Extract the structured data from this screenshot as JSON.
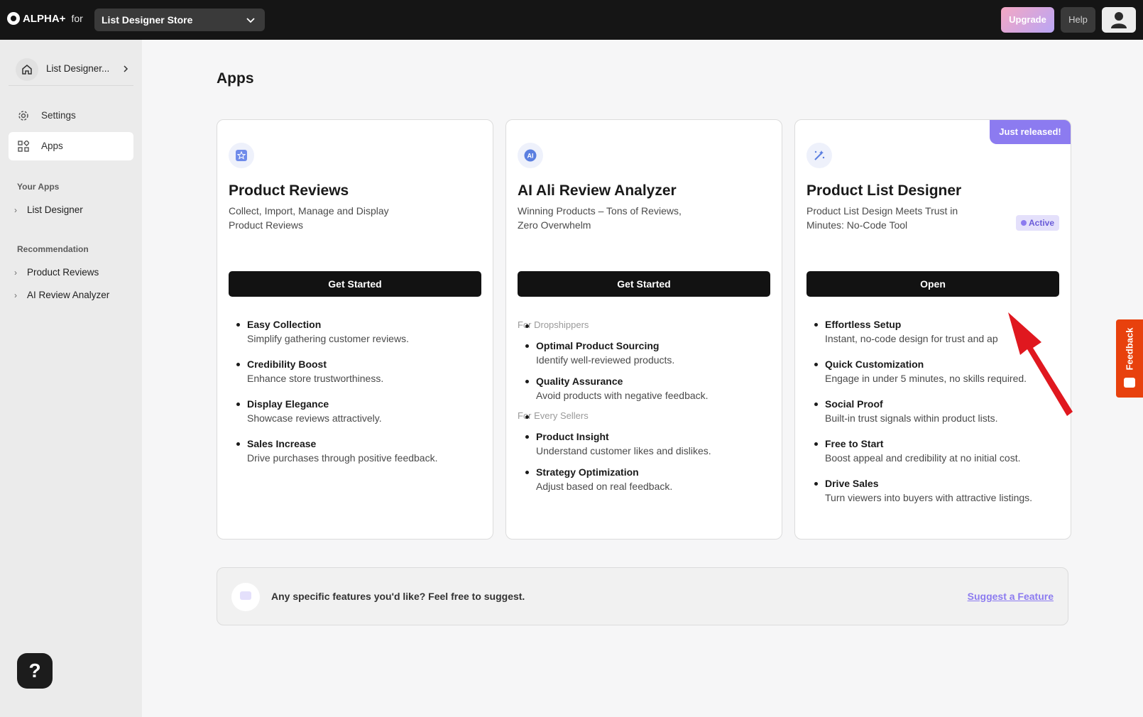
{
  "topbar": {
    "brand": "ALPHA+",
    "for_label": "for",
    "store": "List Designer Store",
    "upgrade": "Upgrade",
    "help": "Help"
  },
  "sidebar": {
    "home_label": "List Designer...",
    "nav": [
      {
        "label": "Settings",
        "icon": "gear-icon"
      },
      {
        "label": "Apps",
        "icon": "apps-grid-icon",
        "active": true
      }
    ],
    "your_apps_title": "Your Apps",
    "your_apps": [
      "List Designer"
    ],
    "recommendation_title": "Recommendation",
    "recommendations": [
      "Product Reviews",
      "AI Review Analyzer"
    ],
    "help_fab": "?"
  },
  "main": {
    "title": "Apps",
    "cards": [
      {
        "name": "Product Reviews",
        "desc": "Collect, Import, Manage and Display Product Reviews",
        "cta": "Get Started",
        "features": [
          {
            "t": "Easy Collection",
            "d": "Simplify gathering customer reviews."
          },
          {
            "t": "Credibility Boost",
            "d": "Enhance store trustworthiness."
          },
          {
            "t": "Display Elegance",
            "d": "Showcase reviews attractively."
          },
          {
            "t": "Sales Increase",
            "d": "Drive purchases through positive feedback."
          }
        ]
      },
      {
        "name": "AI Ali Review Analyzer",
        "icon_text": "AI",
        "desc": "Winning Products – Tons of Reviews, Zero Overwhelm",
        "cta": "Get Started",
        "group1": "For Dropshippers",
        "features1": [
          {
            "t": "Optimal Product Sourcing",
            "d": "Identify well-reviewed products."
          },
          {
            "t": "Quality Assurance",
            "d": "Avoid products with negative feedback."
          }
        ],
        "group2": "For Every Sellers",
        "features2": [
          {
            "t": "Product Insight",
            "d": "Understand customer likes and dislikes."
          },
          {
            "t": "Strategy Optimization",
            "d": "Adjust based on real feedback."
          }
        ]
      },
      {
        "name": "Product List Designer",
        "desc": "Product List Design Meets Trust in Minutes: No-Code Tool",
        "cta": "Open",
        "badge_new": "Just released!",
        "badge_active": "Active",
        "features": [
          {
            "t": "Effortless Setup",
            "d": "Instant, no-code design for trust and ap"
          },
          {
            "t": "Quick Customization",
            "d": "Engage in under 5 minutes, no skills required."
          },
          {
            "t": "Social Proof",
            "d": "Built-in trust signals within product lists."
          },
          {
            "t": "Free to Start",
            "d": "Boost appeal and credibility at no initial cost."
          },
          {
            "t": "Drive Sales",
            "d": "Turn viewers into buyers with attractive listings."
          }
        ]
      }
    ],
    "suggest": {
      "text": "Any specific features you'd like? Feel free to suggest.",
      "link": "Suggest a Feature"
    }
  },
  "feedback_tab": "Feedback",
  "colors": {
    "accent": "#8c7bf0",
    "topbar": "#151515",
    "feedback": "#e8410d",
    "arrow": "#e0181f"
  }
}
